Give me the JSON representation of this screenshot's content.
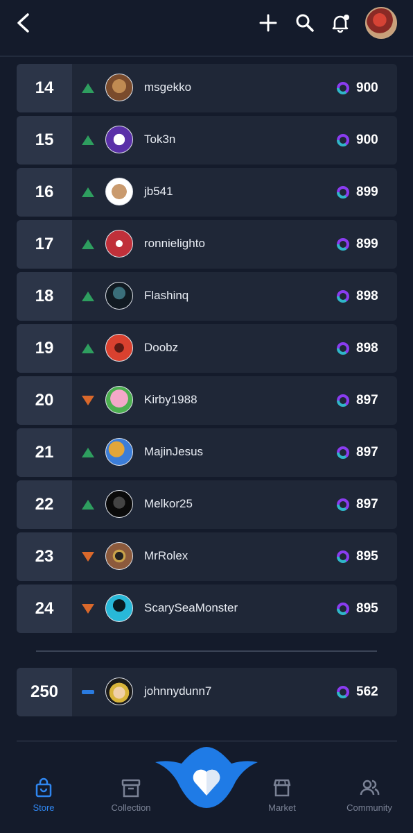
{
  "leaderboard": [
    {
      "rank": "14",
      "trend": "up",
      "name": "msgekko",
      "score": "900",
      "avatar": "#7a4b2c"
    },
    {
      "rank": "15",
      "trend": "up",
      "name": "Tok3n",
      "score": "900",
      "avatar": "#5a30a8"
    },
    {
      "rank": "16",
      "trend": "up",
      "name": "jb541",
      "score": "899",
      "avatar": "#c99a6e"
    },
    {
      "rank": "17",
      "trend": "up",
      "name": "ronnielighto",
      "score": "899",
      "avatar": "#c0303a"
    },
    {
      "rank": "18",
      "trend": "up",
      "name": "Flashinq",
      "score": "898",
      "avatar": "#243b50"
    },
    {
      "rank": "19",
      "trend": "up",
      "name": "Doobz",
      "score": "898",
      "avatar": "#d9412f"
    },
    {
      "rank": "20",
      "trend": "down",
      "name": "Kirby1988",
      "score": "897",
      "avatar": "#f090b8"
    },
    {
      "rank": "21",
      "trend": "up",
      "name": "MajinJesus",
      "score": "897",
      "avatar": "#e2a63a"
    },
    {
      "rank": "22",
      "trend": "up",
      "name": "Melkor25",
      "score": "897",
      "avatar": "#222222"
    },
    {
      "rank": "23",
      "trend": "down",
      "name": "MrRolex",
      "score": "895",
      "avatar": "#8c5a3c"
    },
    {
      "rank": "24",
      "trend": "down",
      "name": "ScarySeaMonster",
      "score": "895",
      "avatar": "#28b8d8"
    }
  ],
  "current_user": {
    "rank": "250",
    "trend": "same",
    "name": "johnnydunn7",
    "score": "562",
    "avatar": "#d8b43a"
  },
  "nav": {
    "store": "Store",
    "collection": "Collection",
    "market": "Market",
    "community": "Community"
  },
  "colors": {
    "accent": "#2f86f0",
    "up": "#2e9e5f",
    "down": "#d9682b"
  }
}
